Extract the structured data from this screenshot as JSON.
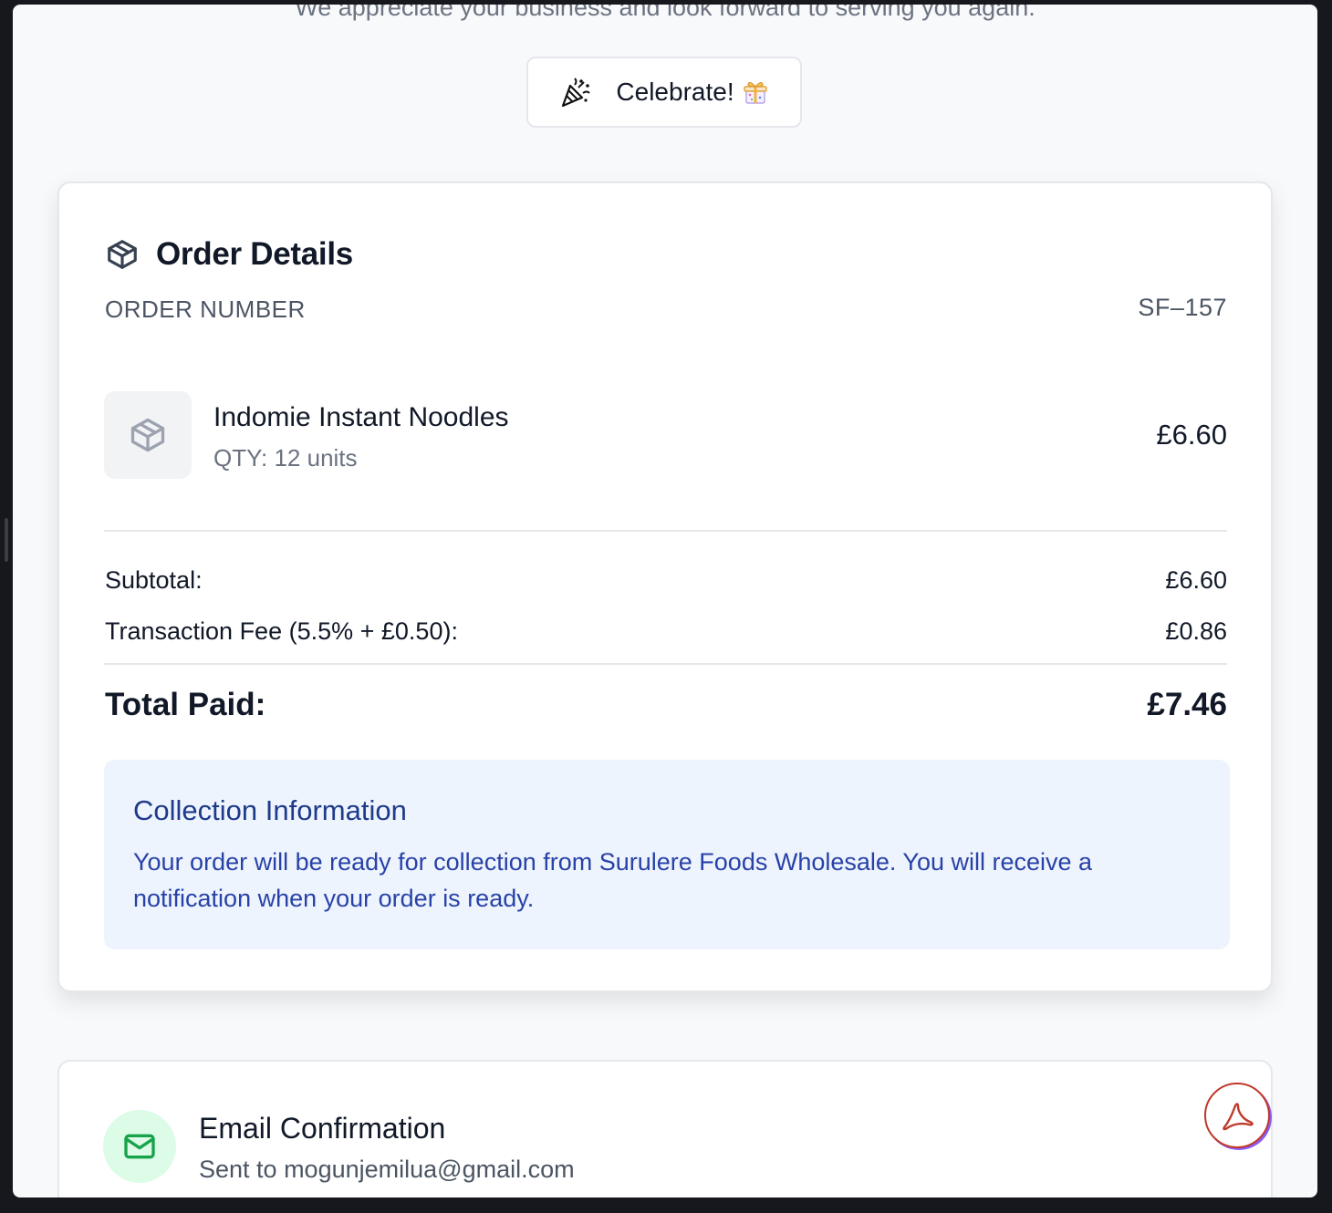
{
  "header": {
    "tagline": "We appreciate your business and look forward to serving you again.",
    "celebrate_label": "Celebrate!"
  },
  "order": {
    "title": "Order Details",
    "number_label": "ORDER NUMBER",
    "number_value": "SF–157",
    "items": [
      {
        "name": "Indomie Instant Noodles",
        "qty": "QTY: 12 units",
        "price": "£6.60"
      }
    ],
    "subtotal_label": "Subtotal:",
    "subtotal_value": "£6.60",
    "fee_label": "Transaction Fee (5.5% + £0.50):",
    "fee_value": "£0.86",
    "total_label": "Total Paid:",
    "total_value": "£7.46"
  },
  "collection": {
    "title": "Collection Information",
    "text": "Your order will be ready for collection from Surulere Foods Wholesale. You will receive a notification when your order is ready."
  },
  "email": {
    "title": "Email Confirmation",
    "subtitle": "Sent to mogunjemilua@gmail.com"
  },
  "icons": {
    "celebrate": "party-popper-icon",
    "gift": "gift-icon",
    "order": "package-icon",
    "item": "package-icon",
    "email": "mail-icon",
    "pdf": "pdf-icon"
  },
  "colors": {
    "info_bg": "#eef4fd",
    "info_title": "#1e3a8a",
    "info_text": "#2842a8",
    "email_icon_bg": "#dcfce7",
    "email_icon": "#16a34a",
    "pdf_red": "#c0392b"
  }
}
